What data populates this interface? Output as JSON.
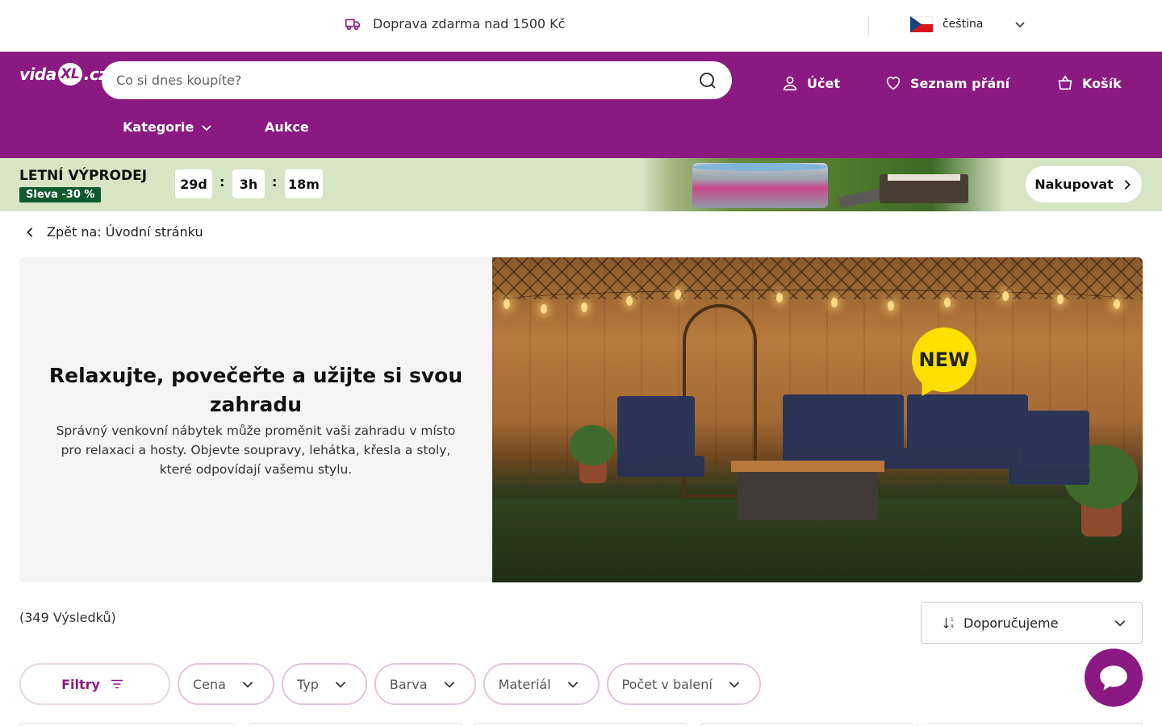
{
  "topbar": {
    "shipping_text": "Doprava zdarma nad 1500 Kč",
    "language": "čeština"
  },
  "header": {
    "logo_left": "vida",
    "logo_mark": "XL",
    "logo_right": ".cz",
    "search_placeholder": "Co si dnes koupíte?",
    "account_label": "Účet",
    "wishlist_label": "Seznam přání",
    "cart_label": "Košík",
    "nav": [
      "Kategorie",
      "Aukce"
    ]
  },
  "promo": {
    "title": "LETNÍ VÝPRODEJ",
    "badge": "Sleva -30 %",
    "countdown": [
      "29d",
      "3h",
      "18m"
    ],
    "separator": ":",
    "cta": "Nakupovat"
  },
  "back_link": "Zpět na: Úvodní stránku",
  "hero": {
    "heading": "Relaxujte, povečeřte a užijte si svou zahradu",
    "body": "Správný venkovní nábytek může proměnit vaši zahradu v místo pro relaxaci a hosty. Objevte soupravy, lehátka, křesla a stoly, které odpovídají vašemu stylu.",
    "badge": "NEW"
  },
  "results": {
    "count_text": "(349 Výsledků)",
    "sort_label": "Doporučujeme"
  },
  "filters": {
    "main_label": "Filtry",
    "items": [
      "Cena",
      "Typ",
      "Barva",
      "Materiál",
      "Počet v balení"
    ]
  },
  "colors": {
    "brand": "#8a1a81",
    "promo_bg": "#d7e5c4",
    "badge_green": "#0f5a2e",
    "new_yellow": "#ffe100"
  }
}
